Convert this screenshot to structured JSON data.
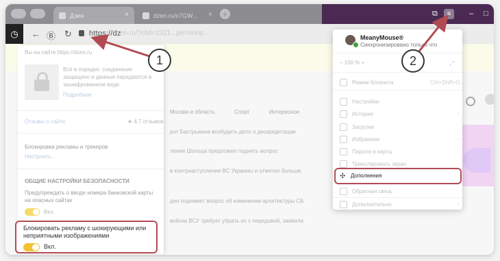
{
  "browser": {
    "active_tab_title": "Дзен",
    "inactive_tab_title": "dzen.ru/x7GW...",
    "url_domain": "https://dz",
    "url_rest": "en.ru/?clid=2321...pe=nnnp...",
    "window_title_icons": [
      "bookmarks-icon",
      "menu-icon",
      "minimize-icon",
      "maximize-icon"
    ]
  },
  "site_panel": {
    "visit_line": "Вы на сайте https://dzen.ru",
    "secure_text": "Всё в порядке: соединение защищено и данные передаются в зашифрованном виде.",
    "details_link": "Подробнее",
    "reviews_label": "Отзывы о сайте",
    "rating": "★ 4.7 отзывов",
    "adblock_title": "Блокировка рекламы и трекеров",
    "adblock_settings": "Настроить...",
    "security_header": "ОБЩИЕ НАСТРОЙКИ БЕЗОПАСНОСТИ",
    "card_warning": "Предупреждать о вводе номера банковской карты на опасных сайтах",
    "card_warning_state": "Вкл.",
    "block_shocking": "Блокировать рекламу с шокирующими или неприятными изображениями",
    "block_shocking_state": "Вкл."
  },
  "page_behind": {
    "nav": [
      "Москва и область",
      "Спорт",
      "Интересное"
    ],
    "news": [
      "рот Бастрыкина возбудить дело о дискредитации",
      "ление Шольца предложил поднять вопрос",
      "в контрнаступление ВС Украины и отметил больше",
      "ден поднимет вопрос об изменении архитектуры СБ",
      "войска ВСУ требует убрать их с передовой, заявила"
    ]
  },
  "menu": {
    "account_name": "MeanyMouse®",
    "account_sync": "Синхронизировано только что",
    "zoom": "100 %",
    "fullscreen_hint": "Режим блокнота",
    "shortcut": "Ctrl+Shift+O",
    "items": [
      {
        "label": "Настройки",
        "icon": "gear-icon"
      },
      {
        "label": "История",
        "icon": "history-icon"
      },
      {
        "label": "Загрузки",
        "icon": "download-icon"
      },
      {
        "label": "Избранное",
        "icon": "star-icon"
      },
      {
        "label": "Пароли и карты",
        "icon": "key-icon"
      },
      {
        "label": "Транслировать экран",
        "icon": "cast-icon"
      }
    ],
    "extensions_label": "Дополнения",
    "after_items": [
      {
        "label": "Обратная связь",
        "icon": "feedback-icon"
      },
      {
        "label": "Дополнительно",
        "icon": "more-icon"
      }
    ]
  },
  "callouts": [
    "1",
    "2"
  ],
  "colors": {
    "highlight": "#b24a53",
    "toggle_on": "#f1c232",
    "titlebar_dark": "#4a2a52"
  }
}
